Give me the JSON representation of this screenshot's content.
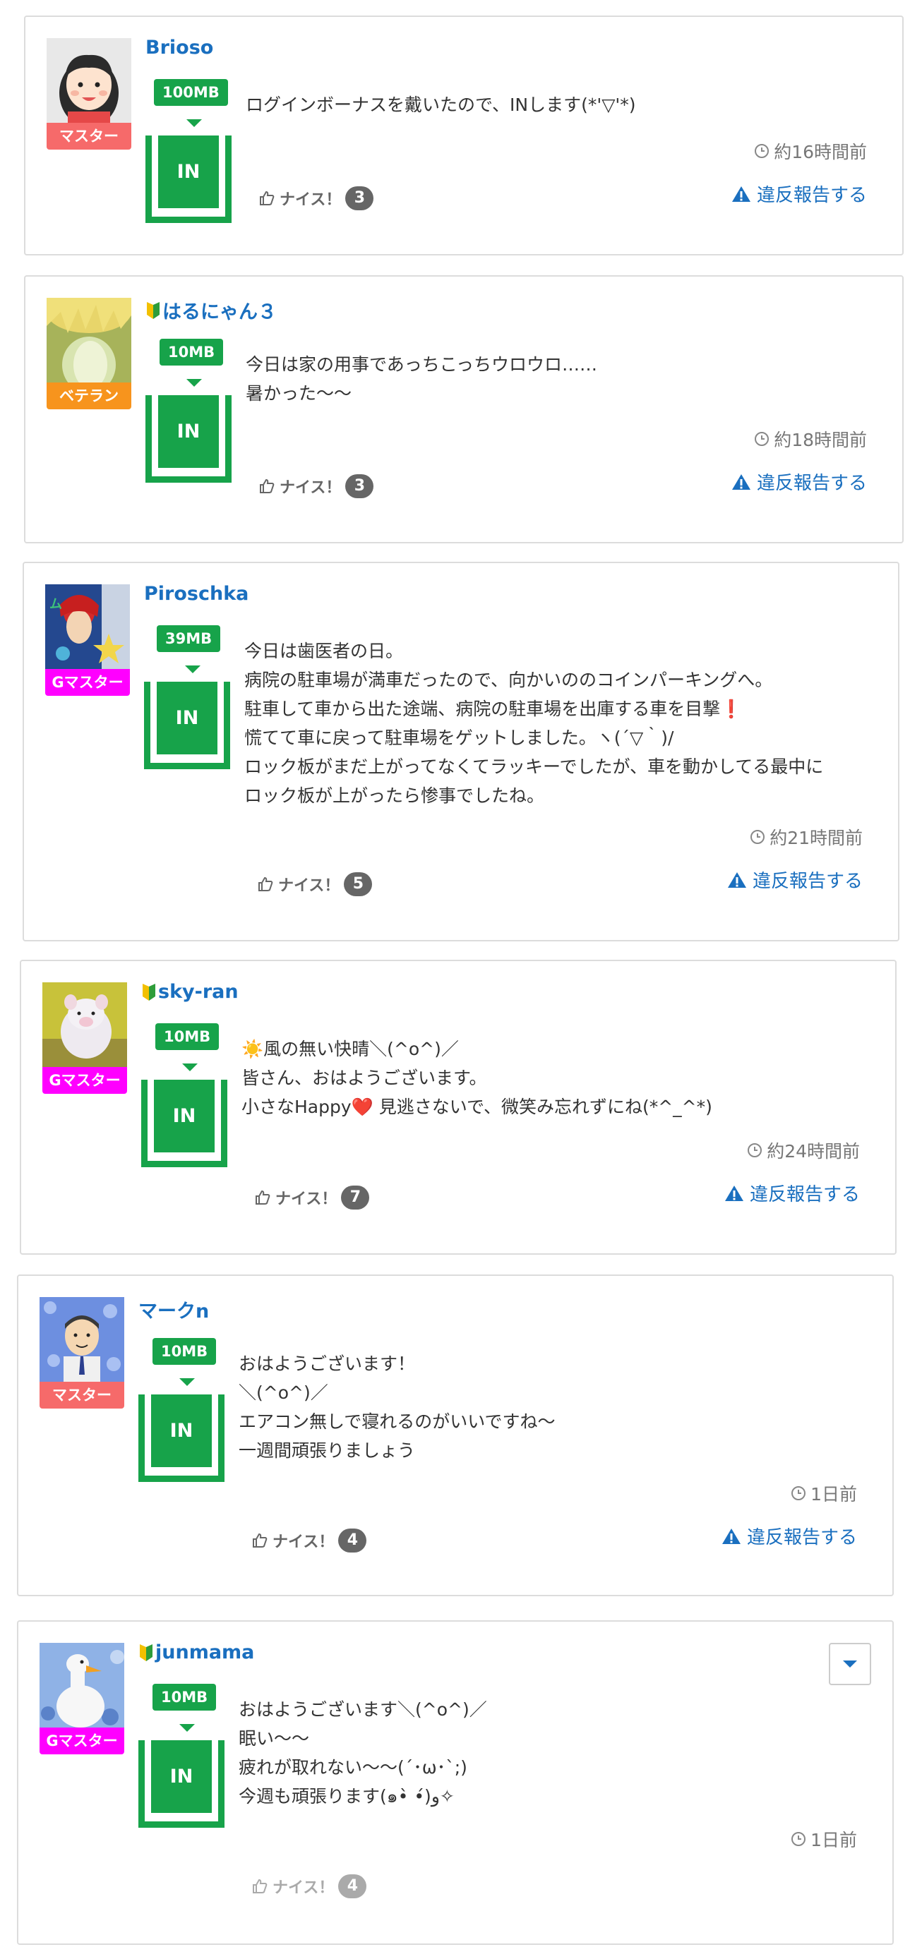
{
  "colors": {
    "accent": "#1a6fbf",
    "in_green": "#17a34a",
    "master": "#f66a6a",
    "veteran": "#f7941d",
    "gmaster": "#ff00ff"
  },
  "labels": {
    "nice": "ナイス！",
    "report": "違反報告する",
    "in": "IN"
  },
  "posts": [
    {
      "user": "Brioso",
      "beginner": false,
      "badge": "マスター",
      "badge_type": "master",
      "mb": "100MB",
      "lines": [
        "ログインボーナスを戴いたので、INします(*'▽'*)"
      ],
      "time": "約16時間前",
      "nice_count": "3"
    },
    {
      "user": "はるにゃん３",
      "beginner": true,
      "badge": "ベテラン",
      "badge_type": "veteran",
      "mb": "10MB",
      "lines": [
        "今日は家の用事であっちこっちウロウロ……",
        "暑かった〜〜"
      ],
      "time": "約18時間前",
      "nice_count": "3"
    },
    {
      "user": "Piroschka",
      "beginner": false,
      "badge": "Gマスター",
      "badge_type": "gmaster",
      "mb": "39MB",
      "lines": [
        "今日は歯医者の日。",
        "病院の駐車場が満車だったので、向かいののコインパーキングへ。",
        "駐車して車から出た途端、病院の駐車場を出庫する車を目撃❗",
        "慌てて車に戻って駐車場をゲットしました。ヽ(´▽｀)/",
        "ロック板がまだ上がってなくてラッキーでしたが、車を動かしてる最中に",
        "ロック板が上がったら惨事でしたね。"
      ],
      "time": "約21時間前",
      "nice_count": "5"
    },
    {
      "user": "sky-ran",
      "beginner": true,
      "badge": "Gマスター",
      "badge_type": "gmaster",
      "mb": "10MB",
      "lines": [
        "☀️風の無い快晴＼(^o^)／",
        "皆さん、おはようございます。",
        "小さなHappy❤️ 見逃さないで、微笑み忘れずにね(*^_^*)"
      ],
      "time": "約24時間前",
      "nice_count": "7"
    },
    {
      "user": "マークn",
      "beginner": false,
      "badge": "マスター",
      "badge_type": "master",
      "mb": "10MB",
      "lines": [
        "おはようございます！",
        "＼(^o^)／",
        "エアコン無しで寝れるのがいいですね〜",
        "一週間頑張りましょう"
      ],
      "time": "1日前",
      "nice_count": "4"
    },
    {
      "user": "junmama",
      "beginner": true,
      "badge": "Gマスター",
      "badge_type": "gmaster",
      "mb": "10MB",
      "lines": [
        "おはようございます＼(^o^)／",
        "眠い〜〜",
        "疲れが取れない〜〜(´･ω･`;)",
        "今週も頑張ります(๑•̀ •́)و✧"
      ],
      "time": "1日前",
      "nice_count": "4"
    }
  ]
}
